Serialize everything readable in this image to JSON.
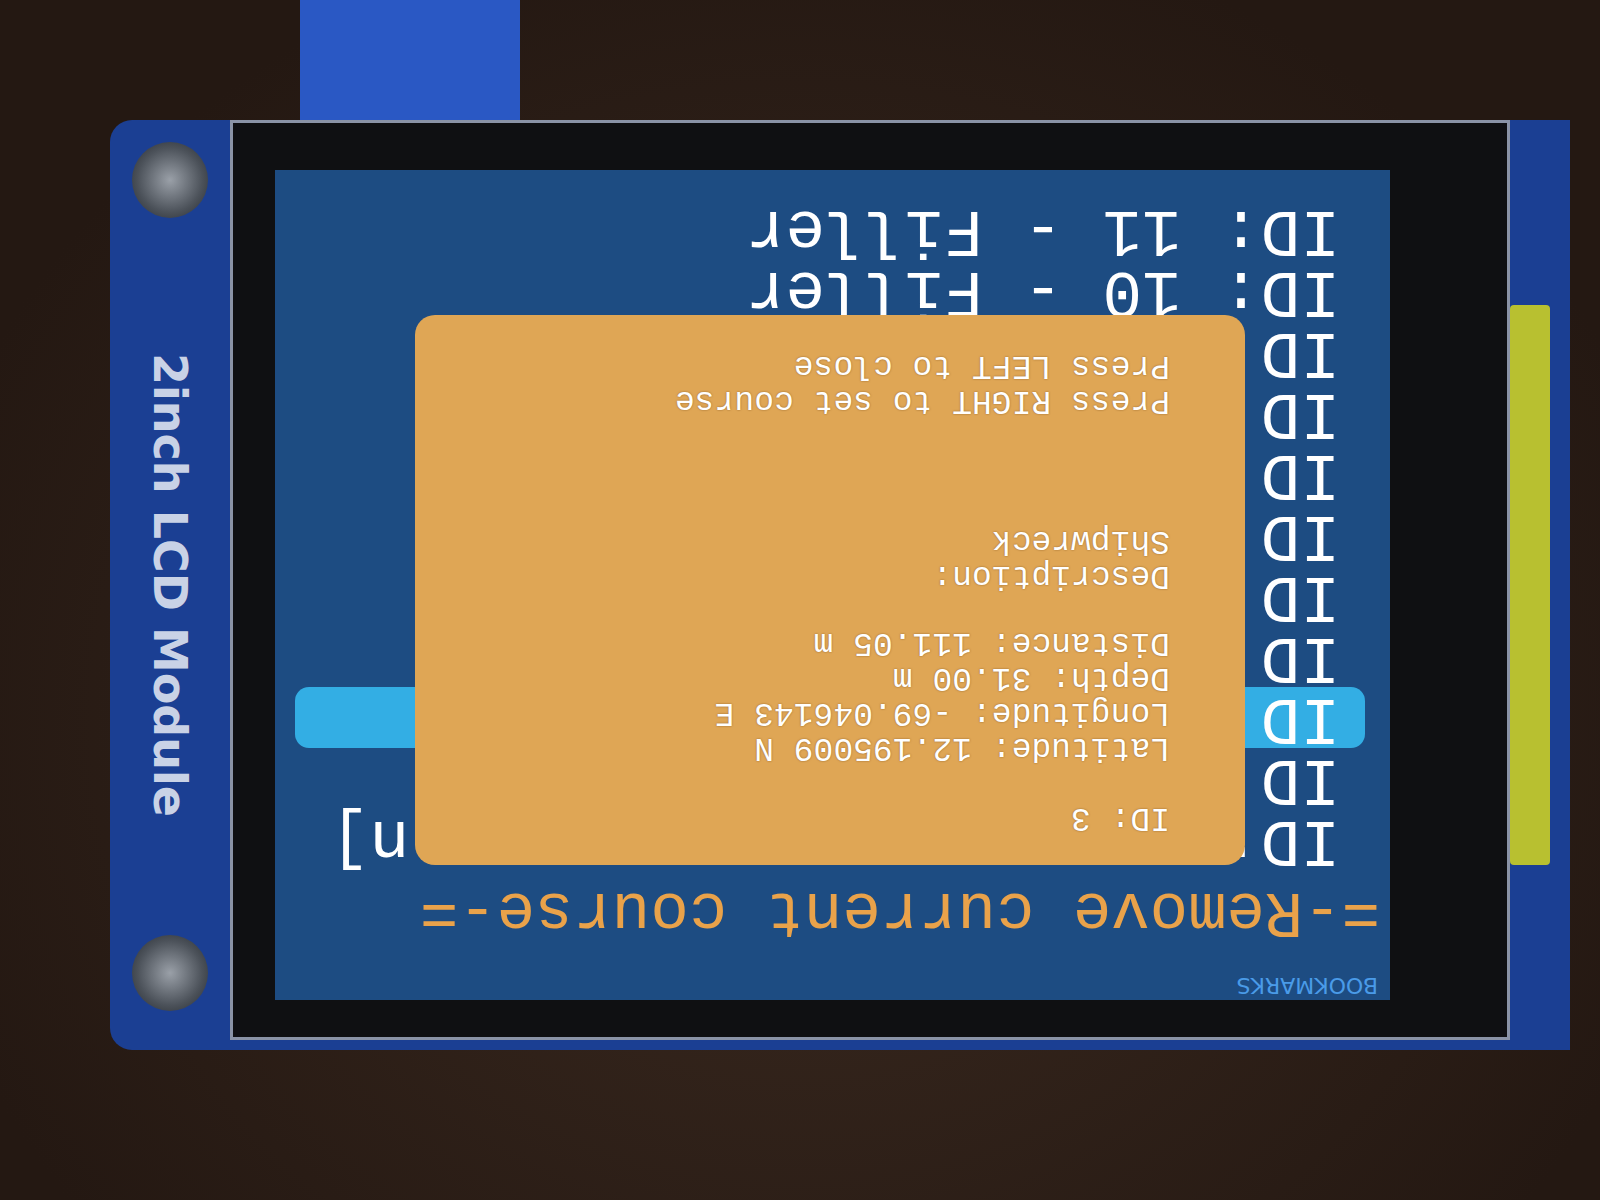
{
  "board": {
    "label": "2inch LCD Module"
  },
  "screen": {
    "title": "BOOKMARKS",
    "action": "=-Remove current course-="
  },
  "rows": [
    {
      "label": "ID:",
      "suffix": "n]",
      "selected": false
    },
    {
      "label": "ID",
      "suffix": "",
      "selected": false
    },
    {
      "label": "ID",
      "suffix": "",
      "selected": true
    },
    {
      "label": "ID",
      "suffix": "",
      "selected": false
    },
    {
      "label": "ID",
      "suffix": "",
      "selected": false
    },
    {
      "label": "ID",
      "suffix": "",
      "selected": false
    },
    {
      "label": "ID",
      "suffix": "",
      "selected": false
    },
    {
      "label": "ID",
      "suffix": "",
      "selected": false
    },
    {
      "label": "ID",
      "suffix": "",
      "selected": false
    },
    {
      "label": "ID: 10 - Filler",
      "suffix": "",
      "selected": false
    },
    {
      "label": "ID: 11 - Filler",
      "suffix": "",
      "selected": false
    }
  ],
  "popup": {
    "id": "ID: 3",
    "fields": [
      "Latitude: 12.195009 N",
      "Longitude: -69.046143 E",
      "Depth: 31.00 m",
      "Distance: 111.05 m"
    ],
    "description_label": "Description:",
    "description": "Shipwreck",
    "hints": [
      "Press RIGHT to set course",
      "Press LEFT to close"
    ]
  }
}
